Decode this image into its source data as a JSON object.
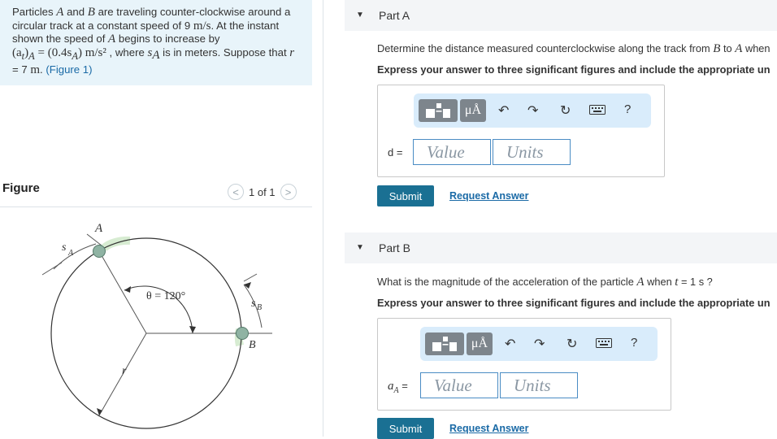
{
  "problem": {
    "p1": "Particles ",
    "a1": "A",
    "p2": " and ",
    "b1": "B",
    "p3": " are traveling counter-clockwise around a circular track at a constant speed of 9 ",
    "unit1": "m/s",
    "p4": ". At the instant shown the speed of ",
    "a2": "A",
    "p5": " begins to increase by",
    "eq": "(a",
    "eq_sub": "t",
    "eq2": ")",
    "eq_sub2": "A",
    "eq3": " = (0.4s",
    "eq_sub3": "A",
    "eq4": ") m/s²",
    "p6": " , where ",
    "sa": "s",
    "sa_sub": "A",
    "p7": " is in meters. Suppose that ",
    "r": "r",
    "p8": " = 7  ",
    "unit2": "m",
    "p9": ". ",
    "figure_link": "(Figure 1)"
  },
  "figure": {
    "title": "Figure",
    "counter": "1 of 1",
    "prev": "<",
    "next": ">",
    "label_A": "A",
    "label_B": "B",
    "label_sA": "s",
    "label_sA_sub": "A",
    "label_sB": "s",
    "label_sB_sub": "B",
    "label_r": "r",
    "label_theta": "θ = 120°"
  },
  "partA": {
    "header": "Part A",
    "question_pre": "Determine the distance measured counterclockwise along the track from ",
    "question_B": "B",
    "question_to": " to ",
    "question_A": "A",
    "question_post": " when",
    "instruction": "Express your answer to three significant figures and include the appropriate un",
    "var_label": "d =",
    "value_placeholder": "Value",
    "units_placeholder": "Units",
    "submit": "Submit",
    "request": "Request Answer"
  },
  "partB": {
    "header": "Part B",
    "question_pre": "What is the magnitude of the acceleration of the particle ",
    "question_A": "A",
    "question_mid": " when ",
    "question_t": "t",
    "question_post": " = 1 s ?",
    "instruction": "Express your answer to three significant figures and include the appropriate un",
    "var_label": "a",
    "var_sub": "A",
    "var_eq": " =",
    "value_placeholder": "Value",
    "units_placeholder": "Units",
    "submit": "Submit",
    "request": "Request Answer"
  },
  "toolbar": {
    "mu_label": "μÅ",
    "help": "?",
    "icons": [
      "templates-icon",
      "units-icon",
      "undo-icon",
      "redo-icon",
      "reset-icon",
      "keyboard-icon",
      "help-icon"
    ]
  },
  "colors": {
    "problem_bg": "#e8f4fa",
    "toolbar_bg": "#d9ecfb",
    "submit_bg": "#1a7093",
    "link": "#1a6aa6",
    "input_border": "#4a8cc4"
  }
}
